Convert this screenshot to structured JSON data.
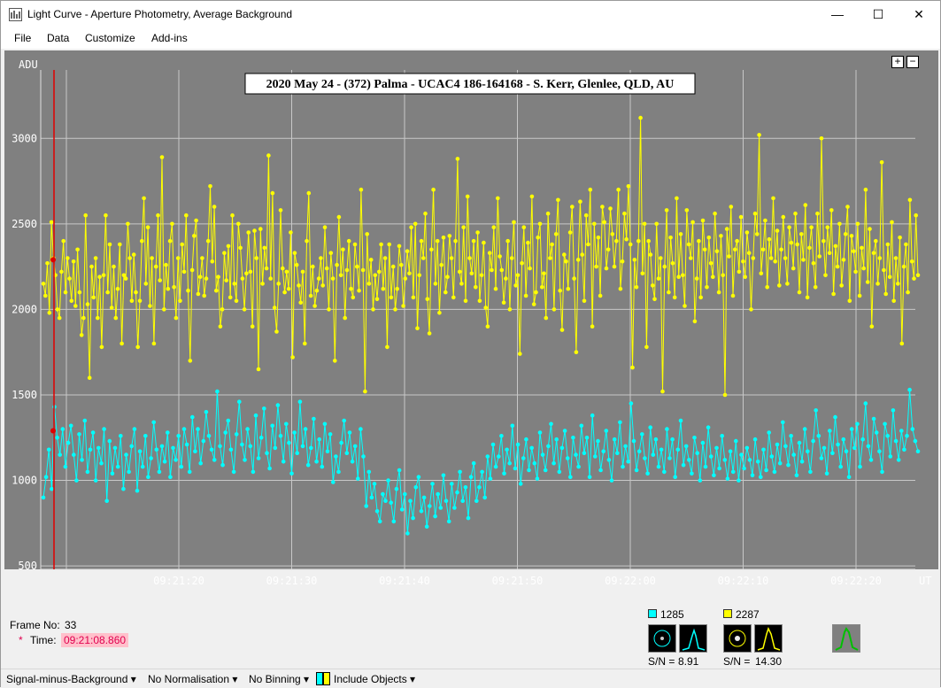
{
  "window": {
    "title": "Light Curve - Aperture Photometry, Average Background"
  },
  "menu": [
    "File",
    "Data",
    "Customize",
    "Add-ins"
  ],
  "chart_data": {
    "type": "scatter",
    "title": "2020 May 24 - (372) Palma - UCAC4 186-164168 - S. Kerr, Glenlee, QLD, AU",
    "ylabel": "ADU",
    "xlabel": "UT",
    "ylim": [
      480,
      3400
    ],
    "y_ticks": [
      500,
      1000,
      1500,
      2000,
      2500,
      3000
    ],
    "x_ticks": [
      "09:21:20",
      "09:21:30",
      "09:21:40",
      "09:21:50",
      "09:22:00",
      "09:22:10",
      "09:22:20"
    ],
    "grid": true,
    "cursor_frame": 33,
    "series": [
      {
        "color": "#ffff00",
        "values": [
          2150,
          2080,
          2270,
          1980,
          2510,
          2300,
          2200,
          2000,
          1950,
          2220,
          2400,
          2100,
          2300,
          2180,
          2050,
          2280,
          2020,
          2350,
          2100,
          1850,
          1950,
          2550,
          2030,
          1600,
          2250,
          2070,
          2300,
          1950,
          2190,
          1780,
          2200,
          2550,
          2100,
          2380,
          2010,
          2250,
          1950,
          2120,
          2380,
          1800,
          2200,
          2180,
          2500,
          2300,
          2050,
          2320,
          2100,
          1780,
          2050,
          2400,
          2650,
          2150,
          2480,
          2020,
          2300,
          1800,
          2250,
          2550,
          2170,
          2890,
          2000,
          2260,
          2120,
          2400,
          2500,
          2130,
          1950,
          2300,
          2050,
          2380,
          2220,
          2550,
          2110,
          1700,
          2230,
          2430,
          2520,
          2090,
          2190,
          2300,
          2080,
          2180,
          2400,
          2720,
          2280,
          2600,
          2110,
          2190,
          1900,
          2000,
          2330,
          2170,
          2370,
          2070,
          2550,
          2150,
          2050,
          2500,
          2360,
          2180,
          2000,
          2210,
          2450,
          2220,
          1900,
          2460,
          2300,
          1650,
          2470,
          2150,
          2360,
          2240,
          2900,
          2180,
          2680,
          2010,
          1870,
          2150,
          2580,
          2240,
          2100,
          2220,
          2120,
          2450,
          1720,
          2330,
          2260,
          2140,
          2040,
          2220,
          1800,
          2400,
          2680,
          2080,
          2250,
          2020,
          2110,
          2180,
          2300,
          2140,
          2480,
          2240,
          2000,
          2330,
          2180,
          1700,
          2260,
          2540,
          2200,
          2350,
          1950,
          2230,
          2400,
          2120,
          2070,
          2380,
          2250,
          2110,
          2700,
          2230,
          1520,
          2440,
          2150,
          2290,
          2000,
          2200,
          2060,
          2220,
          2380,
          2120,
          2300,
          1780,
          2380,
          2070,
          2250,
          2000,
          2120,
          2370,
          2260,
          2020,
          2180,
          2340,
          2210,
          2480,
          2070,
          2500,
          1890,
          2200,
          2400,
          2300,
          2560,
          2060,
          1860,
          2350,
          2700,
          2150,
          2400,
          1980,
          2260,
          2420,
          2100,
          2190,
          2430,
          2300,
          2070,
          2400,
          2880,
          2220,
          2150,
          2480,
          2050,
          2660,
          2300,
          2210,
          2400,
          2130,
          2450,
          2050,
          2200,
          2390,
          2010,
          1900,
          2330,
          2230,
          2480,
          2120,
          2650,
          2310,
          2230,
          2040,
          2180,
          2400,
          2000,
          2300,
          2510,
          2140,
          2200,
          1740,
          2270,
          2480,
          2080,
          2390,
          2240,
          2660,
          2030,
          2100,
          2420,
          2500,
          2130,
          2210,
          1950,
          2560,
          2300,
          2380,
          2000,
          2440,
          2640,
          2110,
          1880,
          2320,
          2280,
          2120,
          2450,
          2600,
          2180,
          1750,
          2290,
          2630,
          2320,
          2050,
          2550,
          2380,
          2700,
          1900,
          2500,
          2250,
          2420,
          2080,
          2600,
          2510,
          2240,
          2350,
          2590,
          2440,
          2250,
          2400,
          2700,
          2120,
          2280,
          2560,
          2410,
          2720,
          2380,
          1660,
          2290,
          2130,
          2400,
          3120,
          2210,
          2500,
          1780,
          2400,
          2320,
          2140,
          2060,
          2500,
          2180,
          2300,
          1520,
          2250,
          2580,
          2100,
          2420,
          2270,
          2070,
          2650,
          2190,
          2440,
          2200,
          2020,
          2580,
          2380,
          2300,
          2510,
          1930,
          2180,
          2400,
          2070,
          2520,
          2350,
          2130,
          2420,
          2270,
          2190,
          2560,
          2340,
          2100,
          2430,
          2200,
          1500,
          2470,
          2310,
          2600,
          2080,
          2350,
          2400,
          2220,
          2540,
          2280,
          2190,
          2450,
          2330,
          2000,
          2300,
          2560,
          2440,
          3020,
          2210,
          2350,
          2520,
          2130,
          2410,
          2300,
          2650,
          2280,
          2460,
          2140,
          2350,
          2540,
          2300,
          2150,
          2480,
          2390,
          2240,
          2560,
          2380,
          2100,
          2440,
          2290,
          2610,
          2070,
          2360,
          2480,
          2270,
          2130,
          2560,
          2310,
          3000,
          2400,
          2200,
          2480,
          2330,
          2580,
          2090,
          2370,
          2250,
          2500,
          2140,
          2290,
          2440,
          2600,
          2050,
          2430,
          2340,
          2220,
          2500,
          2080,
          2360,
          2240,
          2700,
          2160,
          2470,
          1900,
          2330,
          2400,
          2150,
          2300,
          2860,
          2230,
          2090,
          2380,
          2190,
          2510,
          2050,
          2300,
          2150,
          2420,
          1800,
          2250,
          2380,
          2100,
          2640,
          2280,
          2180,
          2550,
          2200
        ]
      },
      {
        "color": "#00ffff",
        "values": [
          900,
          1020,
          1180,
          950,
          1430,
          1250,
          1150,
          1300,
          1080,
          1220,
          1320,
          1150,
          1000,
          1270,
          1120,
          1350,
          1050,
          1180,
          1280,
          1000,
          1190,
          1100,
          1300,
          880,
          1230,
          1040,
          1190,
          1080,
          1260,
          950,
          1150,
          1050,
          1200,
          1300,
          940,
          1170,
          1080,
          1260,
          1020,
          1130,
          1340,
          1180,
          1050,
          1200,
          1110,
          1280,
          1020,
          1190,
          1120,
          1260,
          1080,
          1300,
          1210,
          1050,
          1370,
          1170,
          1300,
          1100,
          1230,
          1400,
          1260,
          1180,
          1120,
          1520,
          1200,
          1090,
          1280,
          1350,
          1180,
          1050,
          1270,
          1460,
          1210,
          1120,
          1300,
          1200,
          1050,
          1380,
          1130,
          1250,
          1420,
          1160,
          1070,
          1320,
          1190,
          1440,
          1260,
          1110,
          1330,
          1220,
          1040,
          1280,
          1160,
          1460,
          1200,
          1300,
          1090,
          1190,
          1360,
          1110,
          1240,
          1080,
          1330,
          1170,
          1270,
          990,
          1140,
          1050,
          1220,
          1350,
          1160,
          1280,
          1110,
          1200,
          1010,
          1300,
          1140,
          850,
          1050,
          900,
          980,
          820,
          760,
          920,
          880,
          1000,
          870,
          760,
          950,
          1060,
          830,
          920,
          690,
          880,
          780,
          960,
          1020,
          820,
          900,
          730,
          850,
          980,
          790,
          920,
          840,
          1030,
          880,
          760,
          980,
          840,
          930,
          1050,
          880,
          960,
          780,
          1020,
          1100,
          880,
          960,
          1050,
          900,
          1140,
          1010,
          1210,
          1080,
          1140,
          1260,
          1040,
          1180,
          1100,
          1320,
          1070,
          1210,
          980,
          1130,
          1240,
          1060,
          1190,
          1100,
          1010,
          1280,
          1150,
          1060,
          1200,
          1330,
          1100,
          1240,
          1050,
          1190,
          1290,
          1130,
          1020,
          1250,
          1150,
          1080,
          1320,
          1160,
          1250,
          1020,
          1380,
          1140,
          1230,
          1060,
          1170,
          1290,
          1120,
          1000,
          1240,
          1160,
          1340,
          1080,
          1200,
          1110,
          1450,
          1230,
          1060,
          1170,
          1270,
          1130,
          1040,
          1310,
          1150,
          1240,
          1080,
          1180,
          1050,
          1300,
          1130,
          1240,
          1020,
          1180,
          1350,
          1090,
          1200,
          1120,
          1040,
          1250,
          1160,
          1000,
          1220,
          1080,
          1310,
          1140,
          1030,
          1190,
          1070,
          1260,
          1120,
          1010,
          1170,
          1050,
          1230,
          1000,
          1150,
          1070,
          1190,
          1120,
          1030,
          1240,
          1110,
          1020,
          1180,
          1060,
          1280,
          1140,
          1050,
          1210,
          1100,
          1340,
          1200,
          1090,
          1260,
          1150,
          1030,
          1220,
          1110,
          1300,
          1170,
          1050,
          1230,
          1410,
          1260,
          1130,
          1190,
          1040,
          1290,
          1160,
          1370,
          1210,
          1080,
          1240,
          1170,
          1020,
          1300,
          1190,
          1330,
          1080,
          1240,
          1450,
          1200,
          1120,
          1360,
          1280,
          1170,
          1050,
          1330,
          1260,
          1140,
          1410,
          1230,
          1120,
          1290,
          1180,
          1260,
          1530,
          1300,
          1230,
          1170
        ]
      }
    ]
  },
  "zoom": {
    "plus": "+",
    "minus": "−"
  },
  "status": {
    "frame_label": "Frame No:",
    "frame_value": "33",
    "time_marker": "*",
    "time_label": "Time:",
    "time_value": "09:21:08.860",
    "obj1": {
      "id": "1285",
      "color": "#00ffff",
      "sn_label": "S/N =",
      "sn_value": "8.91"
    },
    "obj2": {
      "id": "2287",
      "color": "#ffff00",
      "sn_label": "S/N =",
      "sn_value": "14.30"
    }
  },
  "bottombar": {
    "mode": "Signal-minus-Background",
    "normalisation": "No Normalisation",
    "binning": "No Binning",
    "include": "Include Objects"
  }
}
